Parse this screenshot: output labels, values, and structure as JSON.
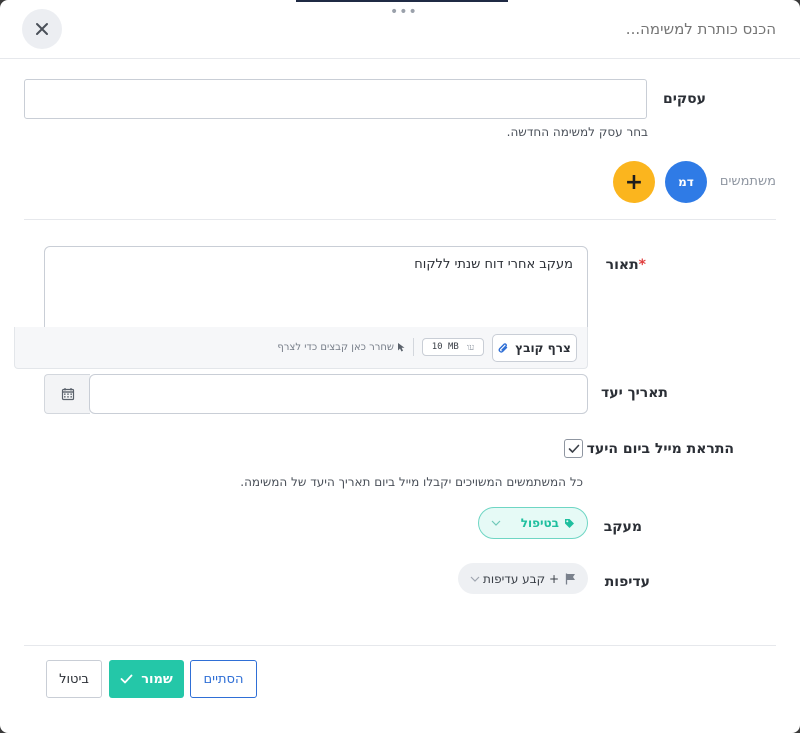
{
  "header": {
    "title_placeholder": "הכנס כותרת למשימה...",
    "drag_handle": "•••"
  },
  "deals": {
    "label": "עסקים",
    "hint": "בחר עסק למשימה החדשה."
  },
  "users": {
    "label": "משתמשים",
    "avatar_initials": "דמ",
    "add_symbol": "+",
    "avatar_color": "#2f7be6",
    "add_color": "#fbb51e"
  },
  "description": {
    "label": "תאור",
    "required_mark": "*",
    "value": "מעקב אחרי דוח שנתי ללקוח",
    "attach_label": "צרף קובץ",
    "size_value": "10 MB",
    "size_unit": "עו",
    "drop_hint": "שחרר כאן קבצים כדי לצרף"
  },
  "due_date": {
    "label": "תאריך יעד",
    "value": ""
  },
  "email_alert": {
    "label": "התראת מייל ביום היעד",
    "checked": true,
    "hint": "כל המשתמשים המשויכים יקבלו מייל ביום תאריך היעד של המשימה."
  },
  "status": {
    "label": "מעקב",
    "value": "בטיפול",
    "color": "#1fbf9f"
  },
  "priority": {
    "label": "עדיפות",
    "value": "+ קבע עדיפות"
  },
  "footer": {
    "done_label": "הסתיים",
    "save_label": "שמור",
    "cancel_label": "ביטול",
    "save_color": "#24c7a8",
    "done_color": "#2f6fd6"
  }
}
